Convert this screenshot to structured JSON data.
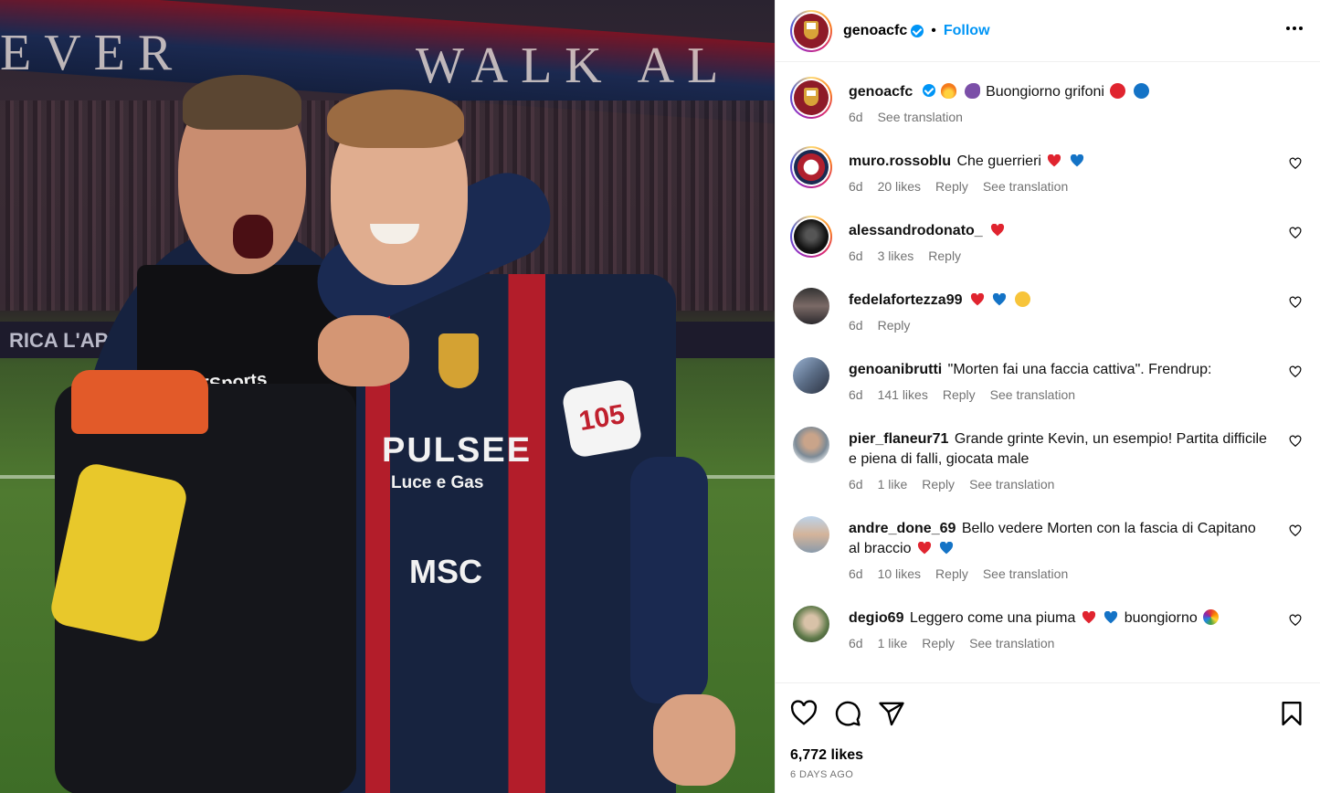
{
  "post": {
    "author": "genoacfc",
    "follow_label": "Follow",
    "dot": "•",
    "more_label": "•••",
    "caption": {
      "user": "genoacfc",
      "text": "Buongiorno grifoni",
      "time": "6d",
      "see_translation": "See translation"
    },
    "likes": "6,772 likes",
    "time_ago": "6 DAYS AGO"
  },
  "photo": {
    "banner_left": "EVER",
    "banner_right": "WALK AL",
    "adboard": "RICA L'AP",
    "jersey_sponsor": "PULSEE",
    "jersey_sub": "Luce e Gas",
    "jersey_msc": "MSC",
    "radio": "105",
    "bib_brand": "STATSports"
  },
  "comments": [
    {
      "user": "muro.rossoblu",
      "text": "Che guerrieri",
      "emojis": [
        "red-heart",
        "blue-heart"
      ],
      "time": "6d",
      "likes": "20 likes",
      "reply": "Reply",
      "translate": "See translation"
    },
    {
      "user": "alessandrodonato_",
      "text": "",
      "emojis": [
        "red-heart"
      ],
      "time": "6d",
      "likes": "3 likes",
      "reply": "Reply"
    },
    {
      "user": "fedelafortezza99",
      "text": "",
      "emojis": [
        "red-heart",
        "blue-heart",
        "heart-eyes"
      ],
      "time": "6d",
      "reply": "Reply"
    },
    {
      "user": "genoanibrutti",
      "text": "\"Morten fai una faccia cattiva\". Frendrup:",
      "time": "6d",
      "likes": "141 likes",
      "reply": "Reply",
      "translate": "See translation"
    },
    {
      "user": "pier_flaneur71",
      "text": "Grande grinte Kevin, un esempio! Partita difficile e piena di falli, giocata male",
      "time": "6d",
      "likes": "1 like",
      "reply": "Reply",
      "translate": "See translation"
    },
    {
      "user": "andre_done_69",
      "text": "Bello vedere Morten con la fascia di Capitano al braccio",
      "emojis": [
        "red-heart",
        "blue-heart"
      ],
      "time": "6d",
      "likes": "10 likes",
      "reply": "Reply",
      "translate": "See translation"
    },
    {
      "user": "degio69",
      "text": "Leggero come una piuma",
      "text2": "buongiorno",
      "time": "6d",
      "likes": "1 like",
      "reply": "Reply",
      "translate": "See translation"
    }
  ],
  "icons": [
    "heart-icon",
    "comment-icon",
    "share-icon",
    "bookmark-icon",
    "more-icon",
    "verified-icon"
  ],
  "colors": {
    "link": "#0095f6",
    "muted": "#737373",
    "verified": "#0095f6"
  }
}
